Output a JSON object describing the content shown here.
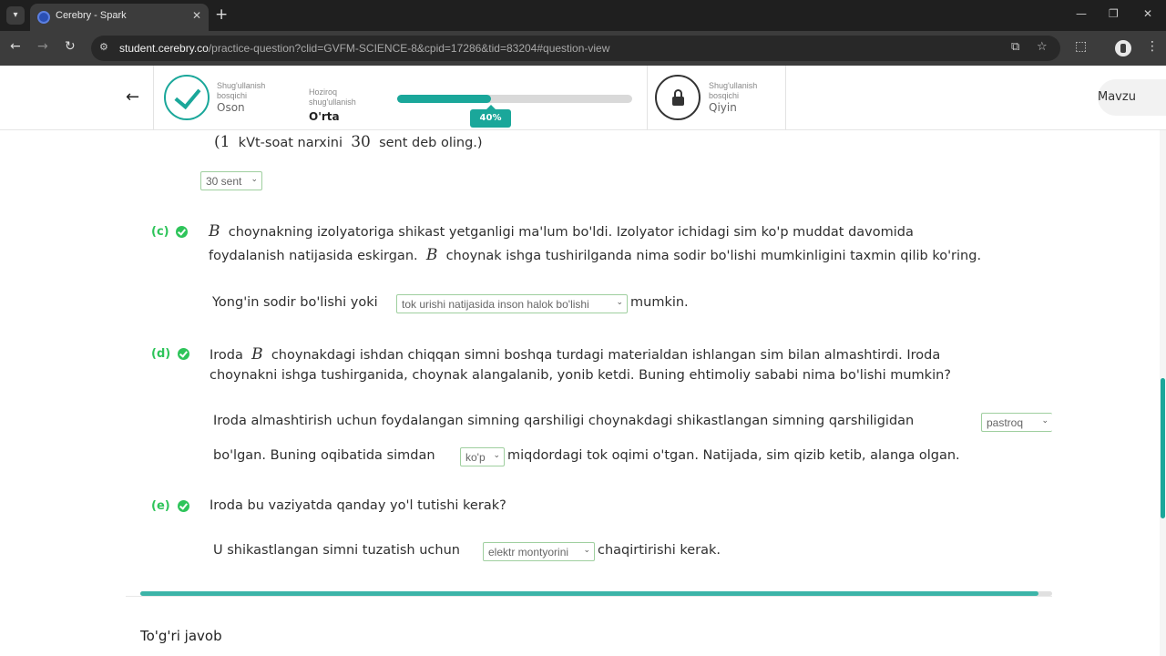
{
  "browser": {
    "tab_title": "Cerebry - Spark",
    "url_host": "student.cerebry.co",
    "url_path": "/practice-question?clid=GVFM-SCIENCE-8&cpid=17286&tid=83204#question-view"
  },
  "header": {
    "prev_level": {
      "caption": "Shug'ullanish bosqichi",
      "name": "Oson"
    },
    "current_level": {
      "caption": "Hoziroq shug'ullanish",
      "name": "O'rta"
    },
    "progress_label": "40%",
    "progress_value": 0.4,
    "next_level": {
      "caption": "Shug'ullanish bosqichi",
      "name": "Qiyin"
    },
    "topic_button": "Mavzu"
  },
  "content": {
    "top_line": {
      "open": "(1",
      "text": "kVt-soat narxini",
      "num": "30",
      "text2": "sent deb oling.)"
    },
    "top_select": "30 sent",
    "part_c": {
      "label": "(c)",
      "var": "B",
      "line1": "choynakning izolyatoriga shikast yetganligi ma'lum bo'ldi. Izolyator ichidagi sim ko'p muddat davomida",
      "line2a": "foydalanish natijasida eskirgan.",
      "line2b": "choynak ishga tushirilganda nima sodir bo'lishi mumkinligini taxmin qilib ko'ring.",
      "answer_pre": "Yong'in sodir bo'lishi yoki",
      "answer_select": "tok urishi natijasida inson halok bo'lishi",
      "answer_post": "mumkin."
    },
    "part_d": {
      "label": "(d)",
      "var": "B",
      "line1a": "Iroda",
      "line1b": "choynakdagi ishdan chiqqan simni boshqa turdagi materialdan ishlangan sim bilan almashtirdi. Iroda",
      "line2": "choynakni ishga tushirganida, choynak alangalanib, yonib ketdi. Buning ehtimoliy sababi nima bo'lishi mumkin?",
      "answer1_pre": "Iroda almashtirish uchun foydalangan simning qarshiligi choynakdagi shikastlangan simning qarshiligidan",
      "answer1_select": "pastroq",
      "answer2_pre": "bo'lgan. Buning oqibatida simdan",
      "answer2_select": "ko'p",
      "answer2_post": "miqdordagi tok oqimi o'tgan. Natijada, sim qizib ketib, alanga olgan."
    },
    "part_e": {
      "label": "(e)",
      "question": "Iroda bu vaziyatda qanday yo'l tutishi kerak?",
      "answer_pre": "U shikastlangan simni tuzatish uchun",
      "answer_select": "elektr montyorini",
      "answer_post": "chaqirtirishi kerak."
    },
    "bottom_progress": 0.985,
    "answer_title": "To'g'ri javob"
  }
}
